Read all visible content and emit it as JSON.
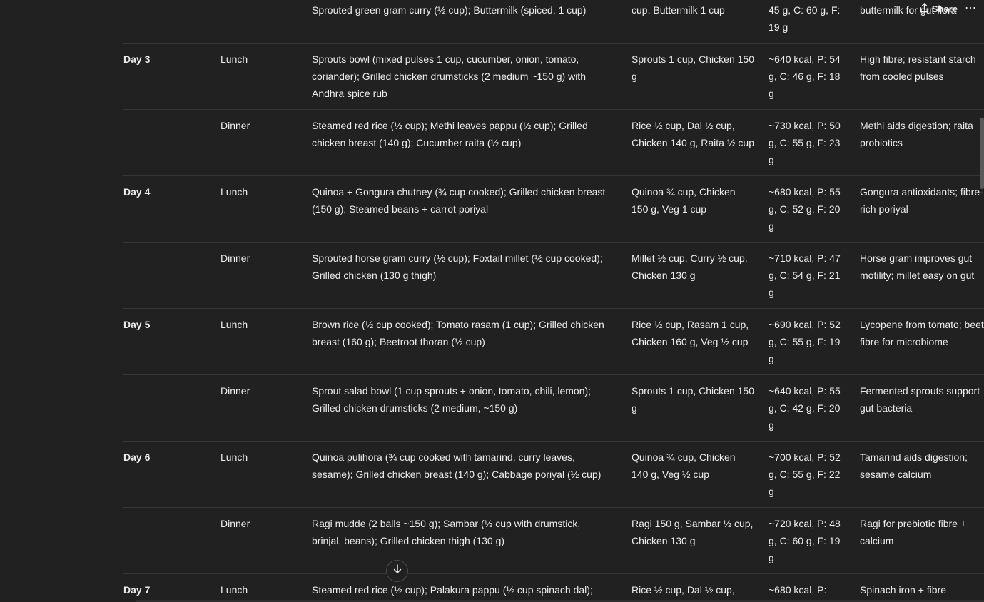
{
  "header": {
    "share_label": "Share",
    "more_label": "⋯"
  },
  "table": {
    "rows": [
      {
        "day": "",
        "meal": "",
        "items": "Sprouted green gram curry (½ cup); Buttermilk (spiced, 1 cup)",
        "portion": "cup, Buttermilk 1 cup",
        "macros": "45 g, C: 60 g, F: 19 g",
        "notes": [
          "buttermilk for gut flora"
        ]
      },
      {
        "day": "Day 3",
        "meal": "Lunch",
        "items": "Sprouts bowl (mixed pulses 1 cup, cucumber, onion, tomato, coriander); Grilled chicken drumsticks (2 medium ~150 g) with Andhra spice rub",
        "portion": "Sprouts 1 cup, Chicken 150 g",
        "macros": "~640 kcal, P: 54 g, C: 46 g, F: 18 g",
        "notes": [
          "High fibre; resistant starch",
          "from cooled pulses"
        ]
      },
      {
        "day": "",
        "meal": "Dinner",
        "items": "Steamed red rice (½ cup); Methi leaves pappu (½ cup); Grilled chicken breast (140 g); Cucumber raita (½ cup)",
        "portion": "Rice ½ cup, Dal ½ cup, Chicken 140 g, Raita ½ cup",
        "macros": "~730 kcal, P: 50 g, C: 55 g, F: 23 g",
        "notes": [
          "Methi aids digestion; raita",
          "probiotics"
        ]
      },
      {
        "day": "Day 4",
        "meal": "Lunch",
        "items": "Quinoa + Gongura chutney (¾ cup cooked); Grilled chicken breast (150 g); Steamed beans + carrot poriyal",
        "portion": "Quinoa ¾ cup, Chicken 150 g, Veg 1 cup",
        "macros": "~680 kcal, P: 55 g, C: 52 g, F: 20 g",
        "notes": [
          "Gongura antioxidants; fibre-",
          "rich poriyal"
        ]
      },
      {
        "day": "",
        "meal": "Dinner",
        "items": "Sprouted horse gram curry (½ cup); Foxtail millet (½ cup cooked); Grilled chicken (130 g thigh)",
        "portion": "Millet ½ cup, Curry ½ cup, Chicken 130 g",
        "macros": "~710 kcal, P: 47 g, C: 54 g, F: 21 g",
        "notes": [
          "Horse gram improves gut",
          "motility; millet easy on gut"
        ]
      },
      {
        "day": "Day 5",
        "meal": "Lunch",
        "items": "Brown rice (½ cup cooked); Tomato rasam (1 cup); Grilled chicken breast (160 g); Beetroot thoran (½ cup)",
        "portion": "Rice ½ cup, Rasam 1 cup, Chicken 160 g, Veg ½ cup",
        "macros": "~690 kcal, P: 52 g, C: 55 g, F: 19 g",
        "notes": [
          "Lycopene from tomato; beet",
          "fibre for microbiome"
        ]
      },
      {
        "day": "",
        "meal": "Dinner",
        "items": "Sprout salad bowl (1 cup sprouts + onion, tomato, chili, lemon); Grilled chicken drumsticks (2 medium, ~150 g)",
        "portion": "Sprouts 1 cup, Chicken 150 g",
        "macros": "~640 kcal, P: 55 g, C: 42 g, F: 20 g",
        "notes": [
          "Fermented sprouts support",
          "gut bacteria"
        ]
      },
      {
        "day": "Day 6",
        "meal": "Lunch",
        "items": "Quinoa pulihora (¾ cup cooked with tamarind, curry leaves, sesame); Grilled chicken breast (140 g); Cabbage poriyal (½ cup)",
        "portion": "Quinoa ¾ cup, Chicken 140 g, Veg ½ cup",
        "macros": "~700 kcal, P: 52 g, C: 55 g, F: 22 g",
        "notes": [
          "Tamarind aids digestion;",
          "sesame calcium"
        ]
      },
      {
        "day": "",
        "meal": "Dinner",
        "items": "Ragi mudde (2 balls ~150 g); Sambar (½ cup with drumstick, brinjal, beans); Grilled chicken thigh (130 g)",
        "portion": "Ragi 150 g, Sambar ½ cup, Chicken 130 g",
        "macros": "~720 kcal, P: 48 g, C: 60 g, F: 19 g",
        "notes": [
          "Ragi for prebiotic fibre +",
          "calcium"
        ]
      },
      {
        "day": "Day 7",
        "meal": "Lunch",
        "items": "Steamed red rice (½ cup); Palakura pappu (½ cup spinach dal);",
        "portion": "Rice ½ cup, Dal ½ cup,",
        "macros": "~680 kcal, P:",
        "notes": [
          "Spinach iron + fibre"
        ]
      }
    ]
  }
}
